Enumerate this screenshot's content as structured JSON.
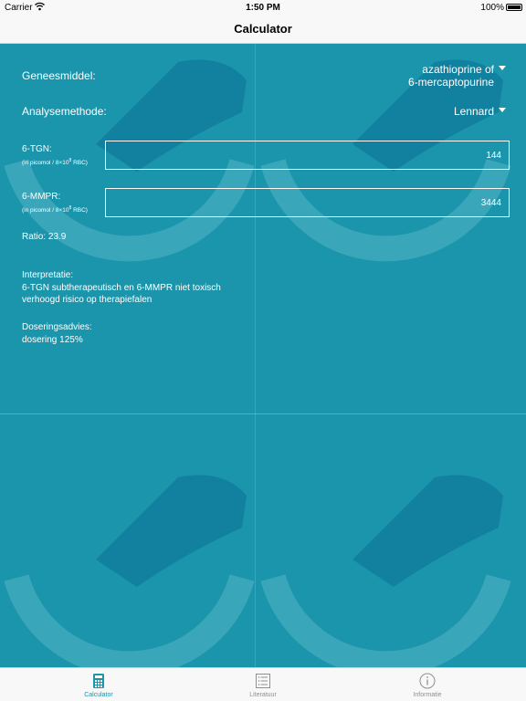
{
  "status_bar": {
    "carrier": "Carrier",
    "time": "1:50 PM",
    "battery": "100%"
  },
  "nav": {
    "title": "Calculator"
  },
  "form": {
    "geneesmiddel_label": "Geneesmiddel:",
    "geneesmiddel_value_line1": "azathioprine of",
    "geneesmiddel_value_line2": "6-mercaptopurine",
    "analysemethode_label": "Analysemethode:",
    "analysemethode_value": "Lennard",
    "tgn_label": "6-TGN:",
    "tgn_unit_prefix": "(in picomol / 8×10",
    "tgn_unit_exp": "8",
    "tgn_unit_suffix": " RBC)",
    "tgn_value": "144",
    "mmpr_label": "6-MMPR:",
    "mmpr_unit_prefix": "(in picomol / 8×10",
    "mmpr_unit_exp": "8",
    "mmpr_unit_suffix": " RBC)",
    "mmpr_value": "3444"
  },
  "result": {
    "ratio": "Ratio: 23.9",
    "interpretatie_label": "Interpretatie:",
    "interpretatie_line1": "6-TGN subtherapeutisch en 6-MMPR niet toxisch",
    "interpretatie_line2": "verhoogd risico op therapiefalen",
    "dosering_label": "Doseringsadvies:",
    "dosering_value": "dosering 125%"
  },
  "tabs": [
    {
      "label": "Calculator",
      "icon": "calculator-icon",
      "active": true
    },
    {
      "label": "Literatuur",
      "icon": "list-icon",
      "active": false
    },
    {
      "label": "Informatie",
      "icon": "info-icon",
      "active": false
    }
  ],
  "colors": {
    "background": "#1a95ab",
    "accent": "#1a95ab",
    "bars": "#f8f8f8",
    "tab_inactive": "#8f8f8f"
  }
}
